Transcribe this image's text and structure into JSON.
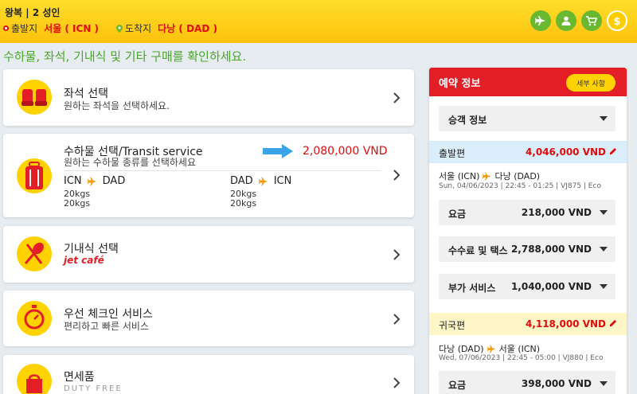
{
  "header": {
    "trip_type": "왕복 | 2 성인",
    "departure_label": "출발지",
    "departure_value": "서울 ( ICN )",
    "arrival_label": "도착지",
    "arrival_value": "다낭 ( DAD )",
    "icons": [
      "plane-icon",
      "user-icon",
      "cart-icon",
      "dollar-icon"
    ]
  },
  "main": {
    "headline": "수하물, 좌석, 기내식 및 기타 구매를 확인하세요.",
    "seat": {
      "title": "좌석 선택",
      "subtitle": "원하는 좌석을 선택하세요."
    },
    "baggage": {
      "title": "수하물 선택/Transit service",
      "subtitle": "원하는 수하물 종류를 선택하세요",
      "price": "2,080,000 VND",
      "legs": [
        {
          "from": "ICN",
          "to": "DAD",
          "kg1": "20kgs",
          "kg2": "20kgs"
        },
        {
          "from": "DAD",
          "to": "ICN",
          "kg1": "20kgs",
          "kg2": "20kgs"
        }
      ]
    },
    "meal": {
      "title": "기내식 선택",
      "subtitle": "jet café"
    },
    "checkin": {
      "title": "우선 체크인 서비스",
      "subtitle": "편리하고 빠른 서비스"
    },
    "dutyfree": {
      "title": "면세품",
      "subtitle": "DUTY FREE"
    }
  },
  "sidebar": {
    "title": "예약 정보",
    "detail_button": "세부 사항",
    "passenger_info": "승객 정보",
    "outbound": {
      "label": "출발편",
      "total": "4,046,000 VND",
      "from": "서울 (ICN)",
      "to": "다낭 (DAD)",
      "meta": "Sun, 04/06/2023 | 22:45 - 01:25 | VJ875 | Eco",
      "fare_label": "요금",
      "fare": "218,000 VND",
      "tax_label": "수수료 및 택스",
      "tax": "2,788,000 VND",
      "addon_label": "부가 서비스",
      "addon": "1,040,000 VND"
    },
    "inbound": {
      "label": "귀국편",
      "total": "4,118,000 VND",
      "from": "다낭 (DAD)",
      "to": "서울 (ICN)",
      "meta": "Wed, 07/06/2023 | 22:45 - 05:00 | VJ880 | Eco",
      "fare_label": "요금",
      "fare": "398,000 VND"
    }
  },
  "colors": {
    "brand_red": "#e31e26",
    "brand_yellow": "#ffd200",
    "green": "#4aa52a"
  }
}
